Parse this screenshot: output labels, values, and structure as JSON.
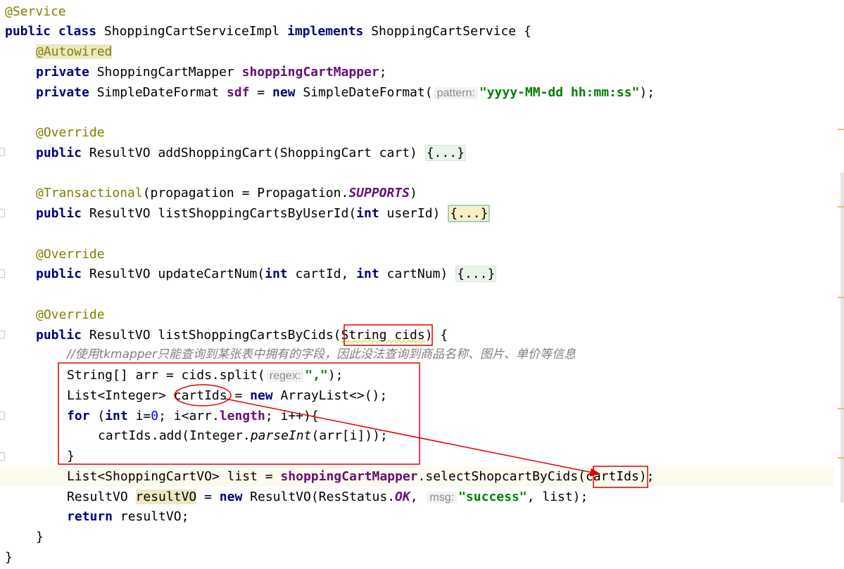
{
  "code": {
    "l1_ann": "@Service",
    "l2_public": "public",
    "l2_class": "class",
    "l2_name": "ShoppingCartServiceImpl",
    "l2_implements": "implements",
    "l2_iface": "ShoppingCartService {",
    "l3_ann": "@Autowired",
    "l4_private": "private",
    "l4_type": "ShoppingCartMapper",
    "l4_field": "shoppingCartMapper",
    "l4_end": ";",
    "l5_private": "private",
    "l5_type": "SimpleDateFormat",
    "l5_field": "sdf",
    "l5_eq": "=",
    "l5_new": "new",
    "l5_ctor": "SimpleDateFormat(",
    "l5_hint": "pattern:",
    "l5_str": "\"yyyy-MM-dd hh:mm:ss\"",
    "l5_end": ");",
    "l7_ann": "@Override",
    "l8_public": "public",
    "l8_sig": "ResultVO addShoppingCart(ShoppingCart cart)",
    "l8_fold": "{...}",
    "l10_ann": "@Transactional",
    "l10_args": "(propagation = Propagation.",
    "l10_const": "SUPPORTS",
    "l10_end": ")",
    "l11_public": "public",
    "l11_sig": "ResultVO listShoppingCartsByUserId(",
    "l11_int": "int",
    "l11_rest": "userId)",
    "l11_fold": "{...}",
    "l13_ann": "@Override",
    "l14_public": "public",
    "l14_sig": "ResultVO updateCartNum(",
    "l14_int1": "int",
    "l14_mid": "cartId,",
    "l14_int2": "int",
    "l14_rest": "cartNum)",
    "l14_fold": "{...}",
    "l16_ann": "@Override",
    "l17_public": "public",
    "l17_sig": "ResultVO listShoppingCartsByCids(",
    "l17_param": "String cids",
    "l17_end": ") {",
    "l18_comment": "//使用tkmapper只能查询到某张表中拥有的字段，因此没法查询到商品名称、图片、单价等信息",
    "l19_a": "String[] arr = cids.split(",
    "l19_hint": "regex:",
    "l19_str": "\",\"",
    "l19_end": ");",
    "l20_a": "List<Integer>",
    "l20_var": "cartIds",
    "l20_eq": "=",
    "l20_new": "new",
    "l20_end": "ArrayList<>();",
    "l21_for": "for",
    "l21_open": "(",
    "l21_int": "int",
    "l21_i": "i=",
    "l21_zero": "0",
    "l21_mid": "; i<arr.",
    "l21_len": "length",
    "l21_end": "; i++){",
    "l22_a": "cartIds.add(Integer.",
    "l22_parse": "parseInt",
    "l22_end": "(arr[i]));",
    "l23_brace": "}",
    "l24_a": "List<ShoppingCartVO> list =",
    "l24_field": "shoppingCartMapper",
    "l24_call": ".selectShopcartByCids(",
    "l24_arg": "cartIds",
    "l24_end": ");",
    "l25_a": "ResultVO",
    "l25_var": "resultVO",
    "l25_eq": "=",
    "l25_new": "new",
    "l25_ctor": "ResultVO(ResStatus.",
    "l25_const": "OK",
    "l25_comma": ",",
    "l25_hint": "msg:",
    "l25_str": "\"success\"",
    "l25_end": ", list);",
    "l26_return": "return",
    "l26_rest": "resultVO;",
    "l27_brace": "}",
    "l28_brace": "}"
  },
  "colors": {
    "keyword": "#000080",
    "annotation": "#808000",
    "field": "#660e7a",
    "string": "#008000",
    "comment": "#808080",
    "number": "#0000ff",
    "markup_red": "#e00000"
  }
}
